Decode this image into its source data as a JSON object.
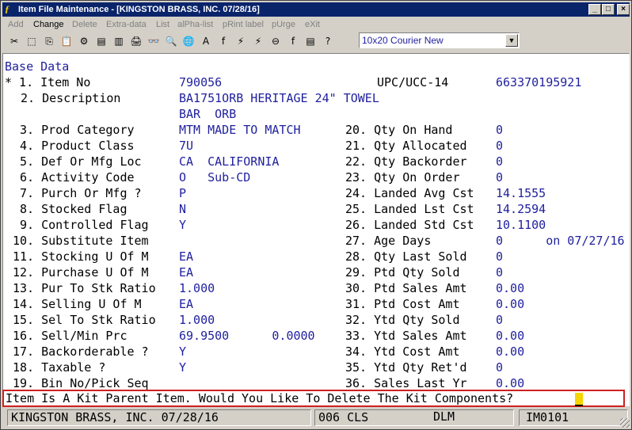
{
  "window": {
    "title": "Item File Maintenance - [KINGSTON BRASS, INC. 07/28/16]",
    "controls": {
      "minimize": "_",
      "maximize": "□",
      "close": "×"
    }
  },
  "menu": [
    "Add",
    "Change",
    "Delete",
    "Extra-data",
    "List",
    "alPha-list",
    "pRint label",
    "pUrge",
    "eXit"
  ],
  "toolbar_icons": [
    "cut-icon",
    "select-icon",
    "copy-icon",
    "paste-icon",
    "gear-icon",
    "form-icon",
    "note-icon",
    "printer-icon",
    "binoculars-icon",
    "magnifier-icon",
    "globe-icon",
    "letter-a-icon",
    "italic-f-icon",
    "lightning-icon",
    "lightning-doc-icon",
    "link-icon",
    "fx-icon",
    "stack-icon",
    "help-pointer-icon"
  ],
  "toolbar_glyphs": [
    "✂",
    "⬚",
    "⎘",
    "📋",
    "⚙",
    "▤",
    "▥",
    "🖨",
    "👓",
    "🔍",
    "🌐",
    "A",
    "f",
    "⚡",
    "⚡",
    "⊖",
    "f",
    "▤",
    "?"
  ],
  "font_select": {
    "value": "10x20 Courier New",
    "arrow": "▼"
  },
  "screen": {
    "header": "Base Data",
    "item_no": {
      "label": "* 1. Item No",
      "value": "790056"
    },
    "upc": {
      "label": "UPC/UCC-14",
      "value": "663370195921"
    },
    "description": {
      "label": "2. Description",
      "line1": "BA1751ORB HERITAGE 24\" TOWEL",
      "line2": "BAR  ORB"
    },
    "left_fields": [
      {
        "label": " 3. Prod Category",
        "value": "MTM MADE TO MATCH"
      },
      {
        "label": " 4. Product Class",
        "value": "7U"
      },
      {
        "label": " 5. Def Or Mfg Loc",
        "value": "CA  CALIFORNIA"
      },
      {
        "label": " 6. Activity Code",
        "value": "O   Sub-CD"
      },
      {
        "label": " 7. Purch Or Mfg ?",
        "value": "P"
      },
      {
        "label": " 8. Stocked Flag",
        "value": "N"
      },
      {
        "label": " 9. Controlled Flag",
        "value": "Y"
      },
      {
        "label": "10. Substitute Item",
        "value": ""
      },
      {
        "label": "11. Stocking U Of M",
        "value": "EA"
      },
      {
        "label": "12. Purchase U Of M",
        "value": "EA"
      },
      {
        "label": "13. Pur To Stk Ratio",
        "value": "1.000"
      },
      {
        "label": "14. Selling U Of M",
        "value": "EA"
      },
      {
        "label": "15. Sel To Stk Ratio",
        "value": "1.000"
      },
      {
        "label": "16. Sell/Min Prc",
        "value": "69.9500      0.0000"
      },
      {
        "label": "17. Backorderable ?",
        "value": "Y"
      },
      {
        "label": "18. Taxable ?",
        "value": "Y"
      },
      {
        "label": "19. Bin No/Pick Seq",
        "value": ""
      }
    ],
    "right_fields": [
      {
        "label": "20. Qty On Hand",
        "value": "0"
      },
      {
        "label": "21. Qty Allocated",
        "value": "0"
      },
      {
        "label": "22. Qty Backorder",
        "value": "0"
      },
      {
        "label": "23. Qty On Order",
        "value": "0"
      },
      {
        "label": "24. Landed Avg Cst",
        "value": "14.1555"
      },
      {
        "label": "25. Landed Lst Cst",
        "value": "14.2594"
      },
      {
        "label": "26. Landed Std Cst",
        "value": "10.1100"
      },
      {
        "label": "27. Age Days",
        "value": "0      on 07/27/16"
      },
      {
        "label": "28. Qty Last Sold",
        "value": "0"
      },
      {
        "label": "29. Ptd Qty Sold",
        "value": "0"
      },
      {
        "label": "30. Ptd Sales Amt",
        "value": "0.00"
      },
      {
        "label": "31. Ptd Cost Amt",
        "value": "0.00"
      },
      {
        "label": "32. Ytd Qty Sold",
        "value": "0"
      },
      {
        "label": "33. Ytd Sales Amt",
        "value": "0.00"
      },
      {
        "label": "34. Ytd Cost Amt",
        "value": "0.00"
      },
      {
        "label": "35. Ytd Qty Ret'd",
        "value": "0"
      },
      {
        "label": "36. Sales Last Yr",
        "value": "0.00"
      }
    ]
  },
  "prompt": "Item Is A Kit Parent Item. Would You Like To Delete The Kit Components?",
  "status": {
    "company": "KINGSTON BRASS, INC. 07/28/16",
    "code": "006 CLS",
    "user": "DLM",
    "program": "IM0101"
  }
}
